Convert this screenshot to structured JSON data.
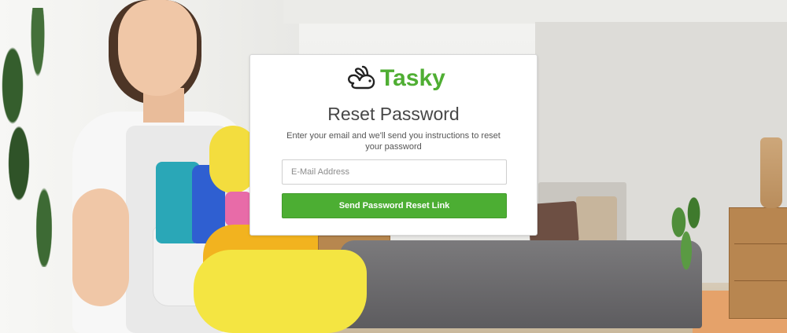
{
  "brand": {
    "name": "Tasky",
    "logo_icon": "rabbit-icon",
    "color": "#4fae33"
  },
  "reset_form": {
    "title": "Reset Password",
    "instructions": "Enter your email and we'll send you instructions to reset your password",
    "email_placeholder": "E-Mail Address",
    "email_value": "",
    "submit_label": "Send Password Reset Link",
    "button_color": "#4cae33"
  }
}
